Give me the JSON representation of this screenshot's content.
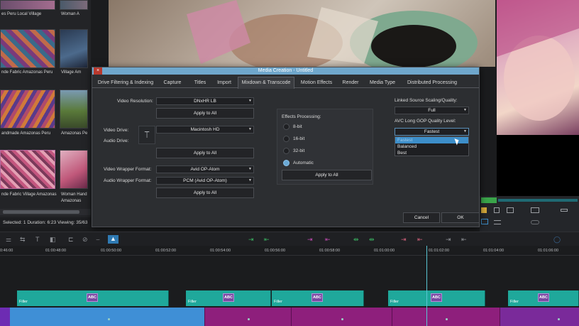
{
  "bin": {
    "captions": [
      "es Peru Local Village",
      "Woman A",
      "nde Fabric Amazonas Peru",
      "Village Am",
      "andmade Amazonas Peru",
      "Amazonas Pe",
      "nde Fabric Village Amazonas",
      "Woman Hand",
      "Amazonas"
    ],
    "status": "Selected: 1  Duration: 6:23  Viewing: 35/63"
  },
  "dialog": {
    "title": "Media Creation - Untitled",
    "close_glyph": "×",
    "tabs": [
      "Drive Filtering & Indexing",
      "Capture",
      "Titles",
      "Import",
      "Mixdown & Transcode",
      "Motion Effects",
      "Render",
      "Media Type",
      "Distributed Processing"
    ],
    "active_tab": "Mixdown & Transcode",
    "video_resolution": {
      "label": "Video Resolution:",
      "value": "DNxHR LB",
      "apply": "Apply to All"
    },
    "video_drive": {
      "label": "Video Drive:",
      "value": "Macintosh HD"
    },
    "audio_drive": {
      "label": "Audio Drive:",
      "apply": "Apply to All"
    },
    "video_wrapper": {
      "label": "Video Wrapper Format:",
      "value": "Avid OP-Atom"
    },
    "audio_wrapper": {
      "label": "Audio Wrapper Format:",
      "value": "PCM (Avid OP-Atom)",
      "apply": "Apply to All"
    },
    "effects": {
      "label": "Effects Processing:",
      "options": [
        "8-bit",
        "16-bit",
        "32-bit",
        "Automatic"
      ],
      "selected": "Automatic",
      "apply": "Apply to All"
    },
    "linked_scaling": {
      "label": "Linked Source Scaling/Quality:",
      "value": "Full"
    },
    "gop": {
      "label": "AVC Long GOP Quality Level:",
      "value": "Fastest",
      "options": [
        "Fastest",
        "Balanced",
        "Best"
      ],
      "highlighted": "Fastest"
    },
    "cancel": "Cancel",
    "ok": "OK"
  },
  "timeline": {
    "timecodes": [
      "0:46:00",
      "01:00:48:00",
      "01:00:50:00",
      "01:00:52:00",
      "01:00:54:00",
      "01:00:56:00",
      "01:00:58:00",
      "01:01:00:00",
      "01:01:02:00",
      "01:01:04:00",
      "01:01:06:00"
    ],
    "clip_name": "Filler",
    "title_badge": "ABC"
  },
  "colors": {
    "accent": "#6fa7cc",
    "teal_clip": "#1fa89b",
    "video_clip_blue": "#3f8fd6",
    "video_clip_magenta": "#8e1f7c",
    "playhead": "#59c6d4"
  }
}
